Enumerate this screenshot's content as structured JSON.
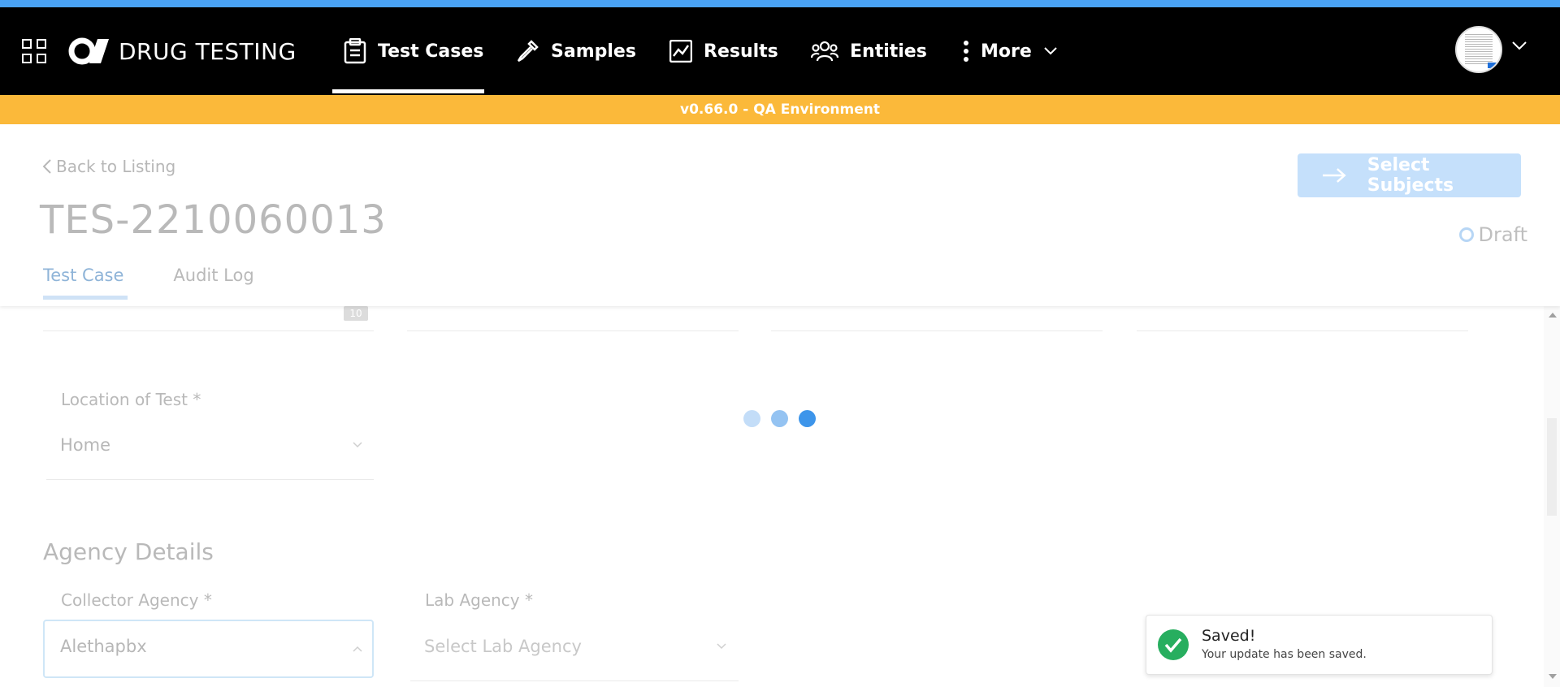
{
  "app": {
    "name": "DRUG TESTING",
    "colors": {
      "nav_bg": "#000000",
      "accent": "#4aa3f5",
      "env_bar": "#fbb93a"
    }
  },
  "nav": {
    "items": [
      {
        "label": "Test Cases",
        "icon": "clipboard-icon",
        "active": true
      },
      {
        "label": "Samples",
        "icon": "pipette-icon"
      },
      {
        "label": "Results",
        "icon": "chart-icon"
      },
      {
        "label": "Entities",
        "icon": "people-icon"
      },
      {
        "label": "More",
        "icon": "more-vertical-icon"
      }
    ]
  },
  "env_banner": "v0.66.0 - QA Environment",
  "header": {
    "back_label": "Back to Listing",
    "title": "TES-2210060013",
    "tabs": [
      "Test Case",
      "Audit Log"
    ],
    "primary_action": "Select Subjects",
    "status": "Draft"
  },
  "form": {
    "date_icon_text": "10",
    "location": {
      "label": "Location of Test *",
      "value": "Home"
    },
    "agency_section": "Agency Details",
    "collector": {
      "label": "Collector Agency *",
      "value": "Alethapbx"
    },
    "lab": {
      "label": "Lab Agency *",
      "placeholder": "Select Lab Agency"
    }
  },
  "toast": {
    "title": "Saved!",
    "message": "Your update has been saved.",
    "color": "#27ae5f"
  }
}
